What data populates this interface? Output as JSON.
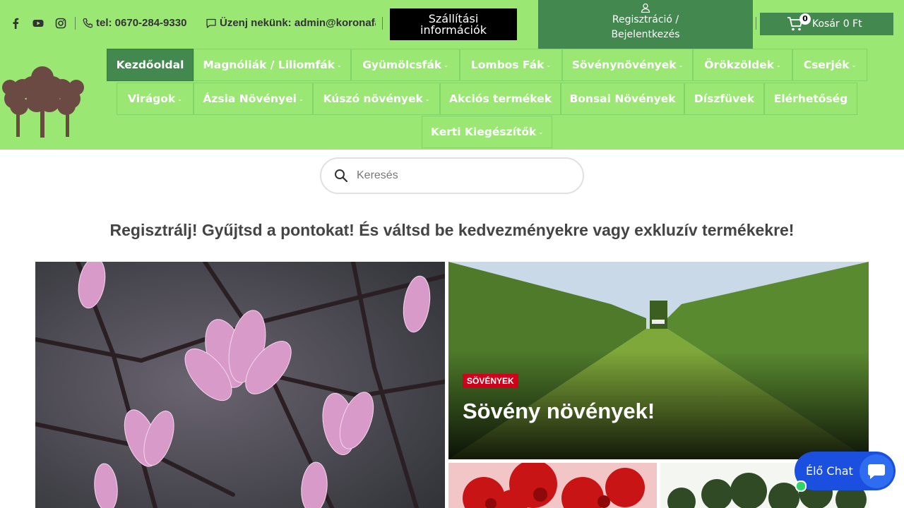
{
  "colors": {
    "header_bg": "#9be774",
    "accent_green": "#43884f",
    "badge_red": "#d0021b",
    "chat_blue": "#1a4fe0"
  },
  "topbar": {
    "social": [
      "facebook-icon",
      "youtube-icon",
      "instagram-icon"
    ],
    "phone": "tel: 0670-284-9330",
    "message": "Üzenj nekünk: admin@koronafa.hu",
    "shipping_button": "Szállítási információk",
    "account": {
      "line1": "Regisztráció /",
      "line2": "Bejelentkezés"
    },
    "cart": {
      "count": "0",
      "label": "Kosár",
      "amount": "0 Ft"
    }
  },
  "nav": {
    "items": [
      {
        "label": "Kezdőoldal",
        "dropdown": false,
        "active": true
      },
      {
        "label": "Magnóliák / Liliomfák",
        "dropdown": true
      },
      {
        "label": "Gyümölcsfák",
        "dropdown": true
      },
      {
        "label": "Lombos Fák",
        "dropdown": true
      },
      {
        "label": "Sövénynövények",
        "dropdown": true
      },
      {
        "label": "Örökzöldek",
        "dropdown": true
      },
      {
        "label": "Cserjék",
        "dropdown": true
      },
      {
        "label": "Virágok",
        "dropdown": true
      },
      {
        "label": "Ázsia Növényei",
        "dropdown": true
      },
      {
        "label": "Kúszó növények",
        "dropdown": true
      },
      {
        "label": "Akciós termékek",
        "dropdown": false
      },
      {
        "label": "Bonsai Növények",
        "dropdown": false
      },
      {
        "label": "Díszfüvek",
        "dropdown": false
      },
      {
        "label": "Elérhetőség",
        "dropdown": false
      },
      {
        "label": "Kerti Kiegészítők",
        "dropdown": true
      }
    ]
  },
  "search": {
    "placeholder": "Keresés"
  },
  "promo": "Regisztrálj! Gyűjtsd a pontokat! És váltsd be kedvezményekre vagy exkluzív termékekre!",
  "featured": {
    "hedge": {
      "badge": "SÖVÉNYEK",
      "title": "Sövény növények!"
    }
  },
  "chat": {
    "label": "Élő Chat"
  }
}
